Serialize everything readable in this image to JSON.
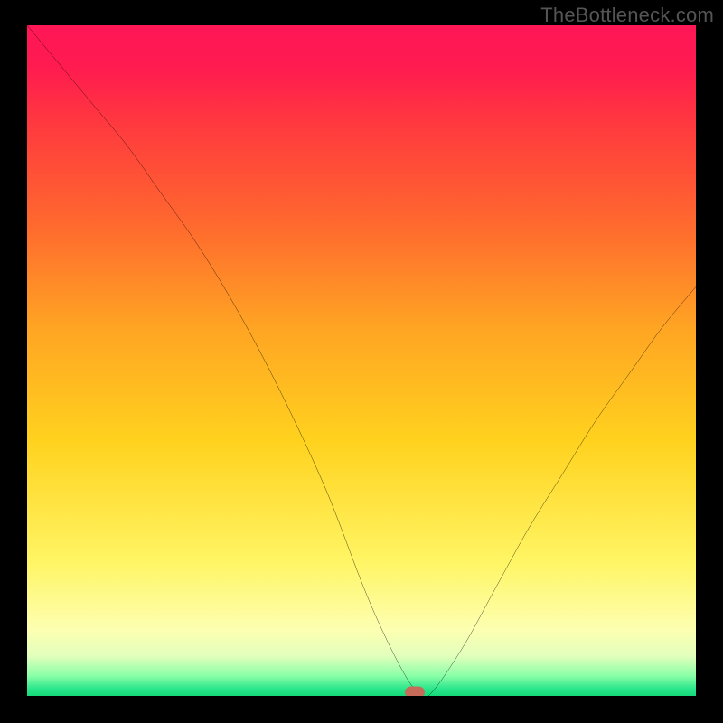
{
  "watermark": {
    "text": "TheBottleneck.com"
  },
  "colors": {
    "frame_bg": "#000000",
    "curve_stroke": "#000000",
    "marker_fill": "#c66b5a",
    "gradient_stops": [
      "#ff1756",
      "#ff1a50",
      "#ff3a3e",
      "#ff6a2e",
      "#ffa423",
      "#ffd21e",
      "#fff564",
      "#fdffb0",
      "#e3ffbc",
      "#8affa7",
      "#28e58b",
      "#16d979"
    ]
  },
  "chart_data": {
    "type": "line",
    "title": "",
    "xlabel": "",
    "ylabel": "",
    "xlim": [
      0,
      100
    ],
    "ylim": [
      0,
      100
    ],
    "grid": false,
    "legend": false,
    "annotations": [
      "TheBottleneck.com"
    ],
    "series": [
      {
        "name": "bottleneck-curve",
        "x": [
          0,
          5,
          10,
          15,
          20,
          25,
          30,
          35,
          40,
          45,
          50,
          53,
          56,
          58,
          60,
          65,
          70,
          75,
          80,
          85,
          90,
          95,
          100
        ],
        "values": [
          100,
          94,
          88,
          82,
          75,
          68,
          60,
          51,
          41,
          30,
          17,
          10,
          4,
          1,
          0,
          7,
          16,
          25,
          33,
          41,
          48,
          55,
          61
        ]
      }
    ],
    "marker": {
      "x": 58,
      "y": 0.5,
      "shape": "pill",
      "color": "#c66b5a"
    }
  }
}
